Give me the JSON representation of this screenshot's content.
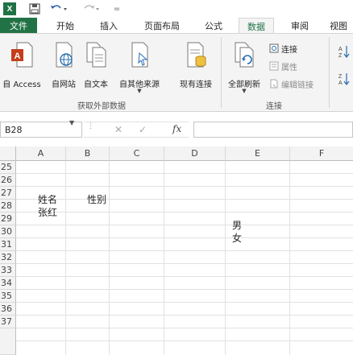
{
  "qat": {
    "logo": "X",
    "more": "="
  },
  "tabs": [
    {
      "label": "文件"
    },
    {
      "label": "开始"
    },
    {
      "label": "插入"
    },
    {
      "label": "页面布局"
    },
    {
      "label": "公式"
    },
    {
      "label": "数据"
    },
    {
      "label": "审阅"
    },
    {
      "label": "视图"
    }
  ],
  "active_tab": "数据",
  "ribbon": {
    "get_external": {
      "buttons": [
        {
          "label": "自 Access"
        },
        {
          "label": "自网站"
        },
        {
          "label": "自文本"
        },
        {
          "label": "自其他来源"
        },
        {
          "label": "现有连接"
        }
      ],
      "group_label": "获取外部数据"
    },
    "connections": {
      "refresh_label": "全部刷新",
      "items": [
        {
          "label": "连接"
        },
        {
          "label": "属性"
        },
        {
          "label": "编辑链接"
        }
      ],
      "group_label": "连接"
    }
  },
  "formula_bar": {
    "name_box": "B28",
    "fx": "fx",
    "cancel": "✕",
    "enter": "✓",
    "value": ""
  },
  "grid": {
    "columns": [
      "A",
      "B",
      "C",
      "D",
      "E",
      "F"
    ],
    "rows": [
      "25",
      "26",
      "27",
      "28",
      "29",
      "30",
      "31",
      "32",
      "33",
      "34",
      "35",
      "36",
      "37"
    ],
    "cells": {
      "a27": "姓名",
      "b27": "性别",
      "a28": "张红",
      "e29": "男",
      "e30": "女"
    }
  },
  "colors": {
    "brand_green": "#217346",
    "access_red": "#c43e1c"
  }
}
